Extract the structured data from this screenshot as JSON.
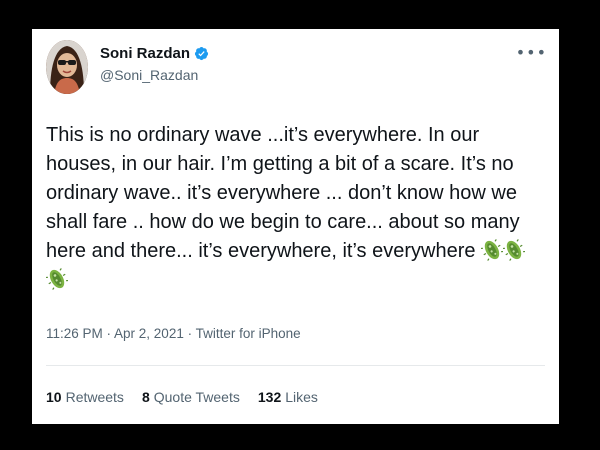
{
  "user": {
    "display_name": "Soni Razdan",
    "handle": "@Soni_Razdan",
    "verified_color": "#1d9bf0"
  },
  "more_icon": "more-options-icon",
  "tweet": {
    "text": "This is no ordinary wave ...it’s everywhere. In our houses, in our hair. I’m getting a bit of a scare. It’s no ordinary wave.. it’s everywhere ... don’t know how we shall fare .. how do we begin to care... about so many here and there... it’s everywhere, it’s everywhere",
    "emoji": "microbe-emoji",
    "emoji_count": 3,
    "meta": "11:26 PM · Apr 2, 2021 · Twitter for iPhone"
  },
  "stats": {
    "retweets_count": "10",
    "retweets_label": "Retweets",
    "quotes_count": "8",
    "quotes_label": "Quote Tweets",
    "likes_count": "132",
    "likes_label": "Likes"
  }
}
